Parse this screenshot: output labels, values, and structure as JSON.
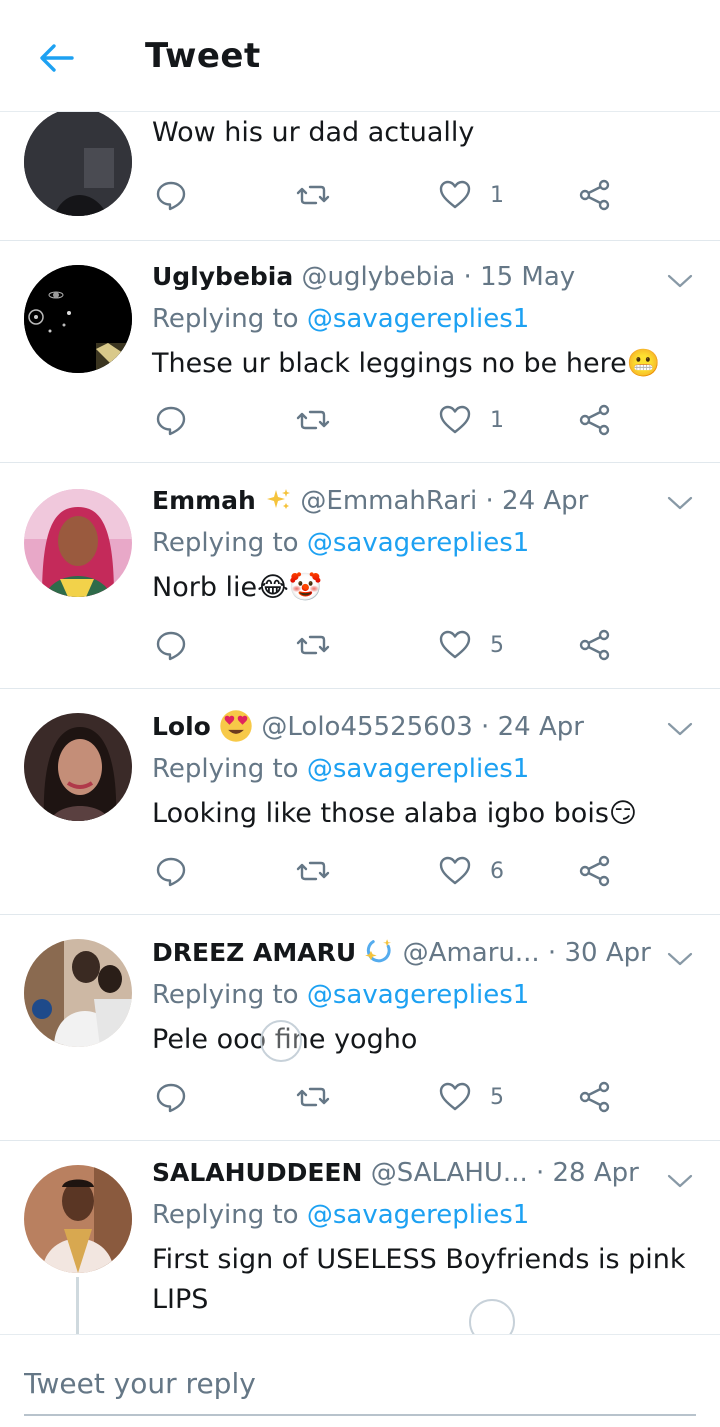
{
  "header": {
    "title": "Tweet"
  },
  "tweets": [
    {
      "name": "",
      "handle": "",
      "date": "",
      "replying_prefix": "",
      "replying_to": "",
      "text": "Wow his ur dad actually",
      "likes": "1"
    },
    {
      "name": "Uglybebia",
      "handle": "@uglybebia",
      "date": "15 May",
      "replying_prefix": "Replying to ",
      "replying_to": "@savagereplies1",
      "text": "These ur black leggings  no be here😬",
      "likes": "1"
    },
    {
      "name": "Emmah",
      "handle": "@EmmahRari",
      "date": "24 Apr",
      "replying_prefix": "Replying to ",
      "replying_to": "@savagereplies1",
      "text": "Norb lie😂🤡",
      "likes": "5"
    },
    {
      "name": "Lolo",
      "handle": "@Lolo45525603",
      "date": "24 Apr",
      "replying_prefix": "Replying to ",
      "replying_to": "@savagereplies1",
      "text": "Looking like those alaba igbo bois😏",
      "likes": "6"
    },
    {
      "name": "DREEZ AMARU",
      "handle": "@Amaru...",
      "date": "30 Apr",
      "replying_prefix": "Replying to ",
      "replying_to": "@savagereplies1",
      "text": "Pele ooo fine yogho",
      "likes": "5"
    },
    {
      "name": "SALAHUDDEEN",
      "handle": "@SALAHU...",
      "date": "28 Apr",
      "replying_prefix": "Replying to ",
      "replying_to": "@savagereplies1",
      "text": "First sign of USELESS Boyfriends is pink LIPS",
      "likes": ""
    }
  ],
  "separator": " · ",
  "compose": {
    "placeholder": "Tweet your reply"
  },
  "colors": {
    "accent": "#1da1f2",
    "secondary_text": "#657786",
    "divider": "#e1e8ed"
  },
  "icons": [
    "back-arrow-icon",
    "reply-icon",
    "retweet-icon",
    "heart-icon",
    "share-icon",
    "chevron-down-icon"
  ]
}
